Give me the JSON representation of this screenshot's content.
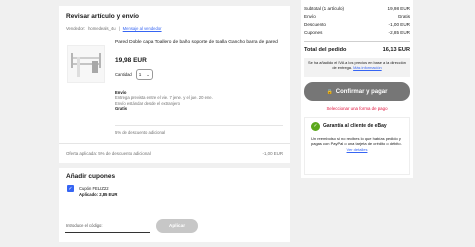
{
  "review": {
    "title": "Revisar artículo y envío",
    "seller_label": "Vendedor:",
    "seller_name": "homedeals_4u",
    "message_link": "Mensaje al vendedor",
    "item_title": "Pared Doble capa Toallero de baño soporte de toalla Gancho barra de pared",
    "price": "19,98 EUR",
    "quantity_label": "Cantidad",
    "quantity_value": "1",
    "shipping_heading": "Envío",
    "delivery_estimate": "Entrega prevista entre el vie. 7 jene. y el jue. 20 ene.",
    "shipping_method": "Envío estándar desde el extranjero",
    "shipping_price": "Gratis",
    "discount_note": "5% de descuento adicional",
    "offer_label": "Oferta aplicada: 5% de descuento adicional",
    "offer_amount": "-1,00 EUR"
  },
  "coupons": {
    "title": "Añadir cupones",
    "coupon_name": "Cupón FELIZ22",
    "coupon_applied": "Aplicado: 2,85 EUR",
    "code_placeholder": "Introduce el código:",
    "apply_label": "Aplicar"
  },
  "summary": {
    "subtotal_label": "Subtotal (1 artículo)",
    "subtotal_value": "19,98 EUR",
    "shipping_label": "Envío",
    "shipping_value": "Gratis",
    "discount_label": "Descuento",
    "discount_value": "-1,00 EUR",
    "coupons_label": "Cupones",
    "coupons_value": "-2,85 EUR",
    "total_label": "Total del pedido",
    "total_value": "16,13 EUR",
    "vat_note": "Se ha añadido el IVA a los precios en base a la dirección de entrega.",
    "more_info": "Más información",
    "confirm_label": "Confirmar y pagar",
    "select_payment": "Seleccionar una forma de pago",
    "guarantee_title": "Garantía al cliente de eBay",
    "guarantee_text": "Un reembolso si no recibes lo que habías pedido y pagas con PayPal o una tarjeta de crédito o débito.",
    "details_link": "Ver detalles"
  },
  "colors": {
    "link": "#3665f3",
    "error": "#e0103a",
    "checkbox": "#3665f3",
    "guarantee": "#5ba71b"
  }
}
